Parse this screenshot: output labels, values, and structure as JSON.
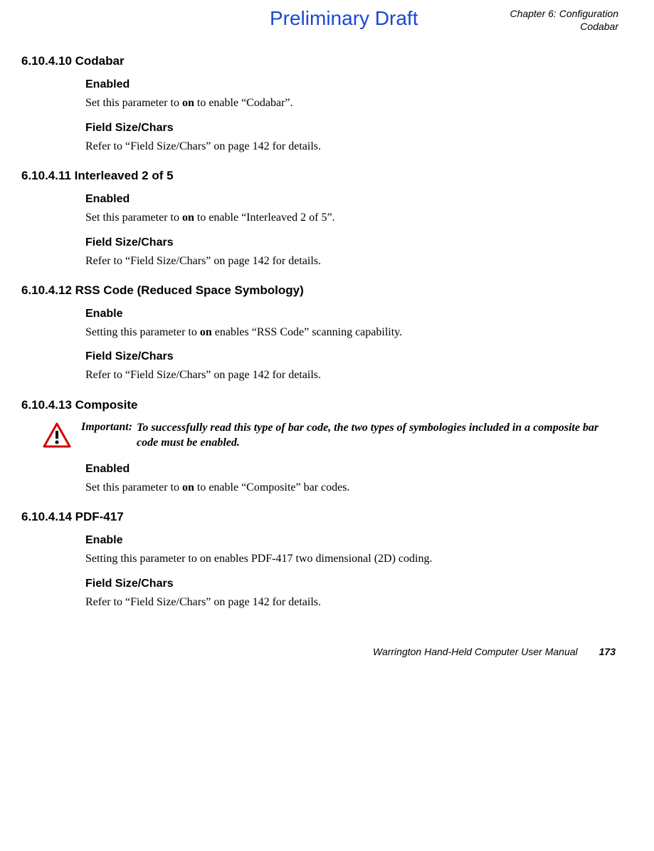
{
  "header": {
    "draft": "Preliminary Draft",
    "chapter": "Chapter 6:  Configuration",
    "section": "Codabar"
  },
  "sections": {
    "s1": {
      "title": "6.10.4.10 Codabar",
      "h1": "Enabled",
      "p1a": "Set this parameter to ",
      "p1b": "on",
      "p1c": " to enable “Codabar”.",
      "h2": "Field Size/Chars",
      "p2": "Refer to “Field Size/Chars” on page 142 for details."
    },
    "s2": {
      "title": "6.10.4.11 Interleaved 2 of 5",
      "h1": "Enabled",
      "p1a": "Set this parameter to ",
      "p1b": "on",
      "p1c": " to enable “Interleaved 2 of 5”.",
      "h2": "Field Size/Chars",
      "p2": "Refer to “Field Size/Chars” on page 142 for details."
    },
    "s3": {
      "title": "6.10.4.12 RSS Code (Reduced Space Symbology)",
      "h1": "Enable",
      "p1a": "Setting this parameter to ",
      "p1b": "on",
      "p1c": " enables “RSS Code” scanning capability.",
      "h2": "Field Size/Chars",
      "p2": "Refer to “Field Size/Chars” on page 142 for details."
    },
    "s4": {
      "title": "6.10.4.13 Composite",
      "important_label": "Important:",
      "important_text": "To successfully read this type of bar code, the two types of symbologies included in a composite bar code must be enabled.",
      "h1": "Enabled",
      "p1a": "Set this parameter to ",
      "p1b": "on",
      "p1c": " to enable “Composite” bar codes."
    },
    "s5": {
      "title": "6.10.4.14 PDF-417",
      "h1": "Enable",
      "p1": "Setting this parameter to on enables PDF-417 two dimensional (2D) coding.",
      "h2": "Field Size/Chars",
      "p2": "Refer to “Field Size/Chars” on page 142 for details."
    }
  },
  "footer": {
    "title": "Warrington Hand-Held Computer User Manual",
    "page": "173"
  }
}
